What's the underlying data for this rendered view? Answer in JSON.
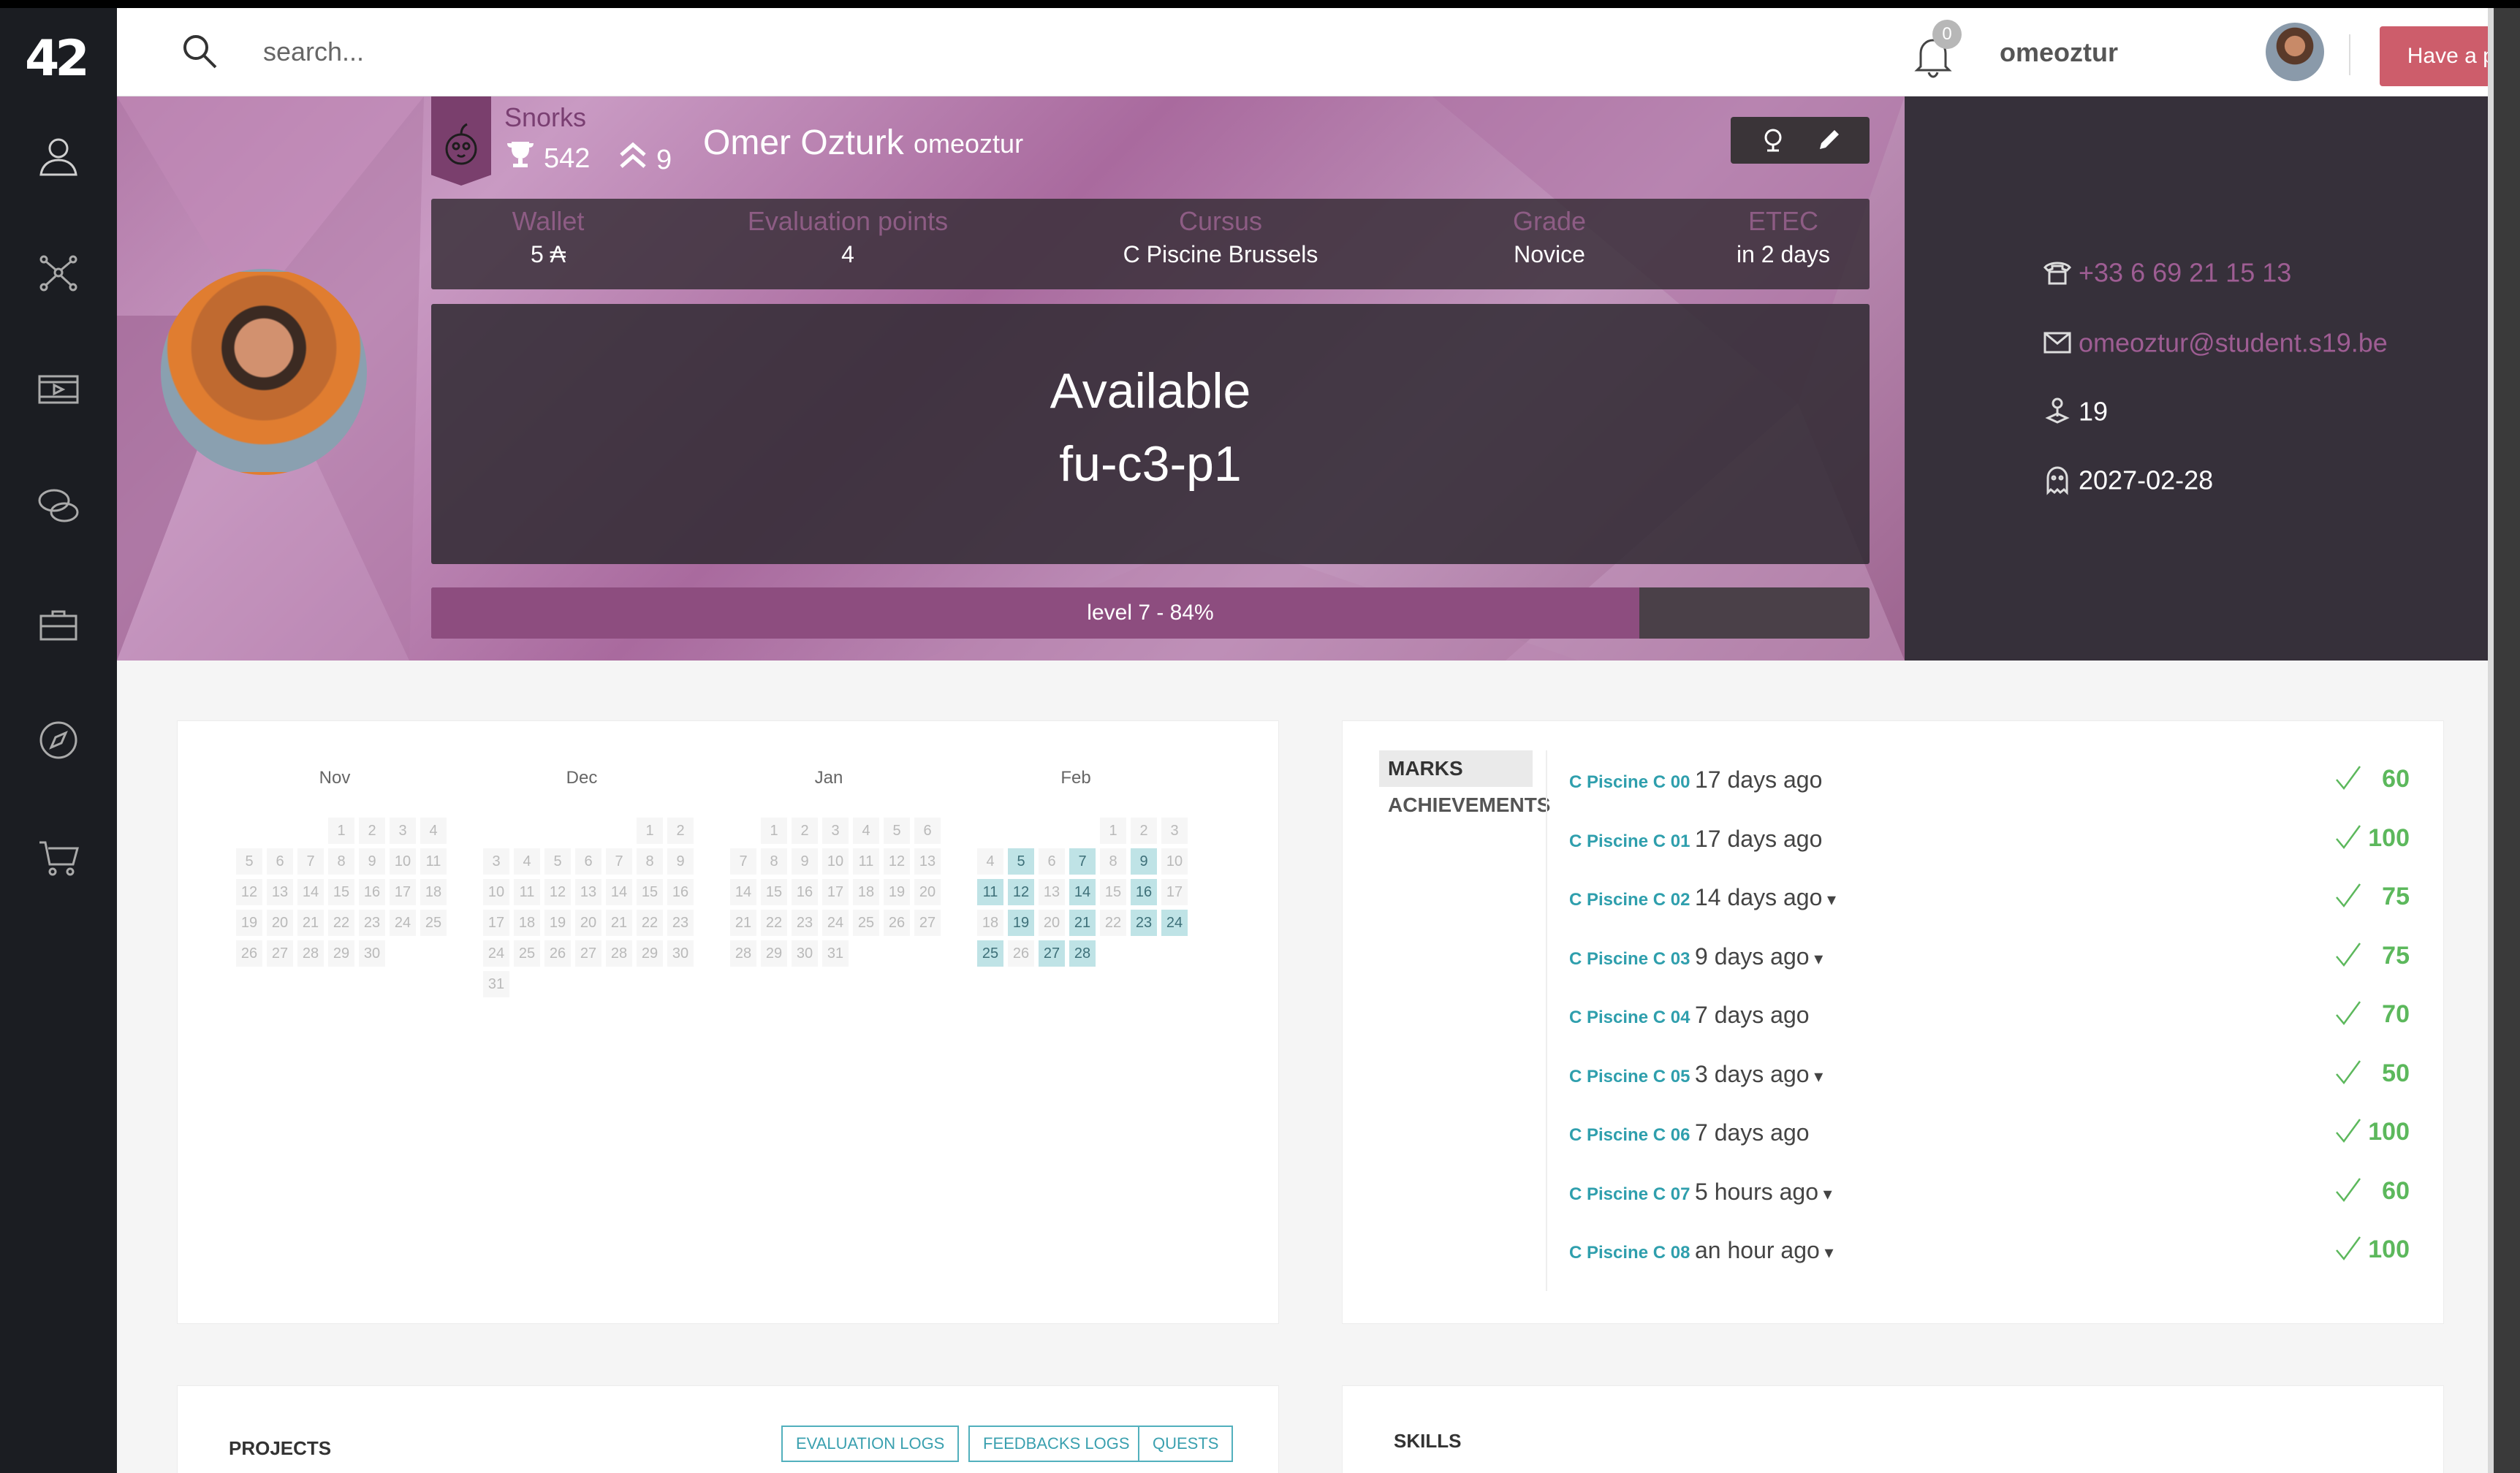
{
  "app": {
    "logo": "42"
  },
  "sidebar": {
    "items": [
      {
        "icon": "profile-icon"
      },
      {
        "icon": "network-icon"
      },
      {
        "icon": "video-icon"
      },
      {
        "icon": "chat-icon"
      },
      {
        "icon": "briefcase-icon"
      },
      {
        "icon": "compass-icon"
      },
      {
        "icon": "cart-icon"
      }
    ]
  },
  "topbar": {
    "search_placeholder": "search...",
    "notification_count": "0",
    "username": "omeoztur",
    "problem_button": "Have a problem?"
  },
  "profile": {
    "coalition": "Snorks",
    "points": "542",
    "rank": "9",
    "full_name": "Omer Ozturk",
    "login": "omeoztur",
    "info": [
      {
        "label": "Wallet",
        "value": "5 ₳"
      },
      {
        "label": "Evaluation points",
        "value": "4"
      },
      {
        "label": "Cursus",
        "value": "C Piscine Brussels"
      },
      {
        "label": "Grade",
        "value": "Novice"
      },
      {
        "label": "ETEC",
        "value": "in 2 days"
      }
    ],
    "availability_line1": "Available",
    "availability_line2": "fu-c3-p1",
    "level_text": "level 7 - 84%",
    "level_progress": 0.84,
    "phone": "+33 6 69 21 15 13",
    "email": "omeoztur@student.s19.be",
    "campus": "19",
    "end_date": "2027-02-28"
  },
  "calendar": {
    "months": [
      {
        "name": "Nov",
        "first_weekday": 3,
        "days": 30,
        "highlighted": []
      },
      {
        "name": "Dec",
        "first_weekday": 5,
        "days": 31,
        "highlighted": []
      },
      {
        "name": "Jan",
        "first_weekday": 1,
        "days": 31,
        "highlighted": []
      },
      {
        "name": "Feb",
        "first_weekday": 4,
        "days": 28,
        "highlighted": [
          5,
          7,
          9,
          11,
          12,
          14,
          16,
          19,
          21,
          23,
          24,
          25,
          27,
          28
        ]
      }
    ]
  },
  "marks": {
    "tabs": [
      "MARKS",
      "ACHIEVEMENTS"
    ],
    "items": [
      {
        "project": "C Piscine C 00",
        "when": "17 days ago",
        "caret": false,
        "score": "60"
      },
      {
        "project": "C Piscine C 01",
        "when": "17 days ago",
        "caret": false,
        "score": "100"
      },
      {
        "project": "C Piscine C 02",
        "when": "14 days ago",
        "caret": true,
        "score": "75"
      },
      {
        "project": "C Piscine C 03",
        "when": "9 days ago",
        "caret": true,
        "score": "75"
      },
      {
        "project": "C Piscine C 04",
        "when": "7 days ago",
        "caret": false,
        "score": "70"
      },
      {
        "project": "C Piscine C 05",
        "when": "3 days ago",
        "caret": true,
        "score": "50"
      },
      {
        "project": "C Piscine C 06",
        "when": "7 days ago",
        "caret": false,
        "score": "100"
      },
      {
        "project": "C Piscine C 07",
        "when": "5 hours ago",
        "caret": true,
        "score": "60"
      },
      {
        "project": "C Piscine C 08",
        "when": "an hour ago",
        "caret": true,
        "score": "100"
      }
    ]
  },
  "projects": {
    "title": "PROJECTS",
    "buttons": [
      "EVALUATION LOGS",
      "FEEDBACKS LOGS",
      "QUESTS"
    ]
  },
  "skills": {
    "title": "SKILLS"
  },
  "colors": {
    "accent": "#2f9fad",
    "banner": "#b27aa8",
    "problem": "#cd5d6b",
    "success": "#5cb85c"
  }
}
